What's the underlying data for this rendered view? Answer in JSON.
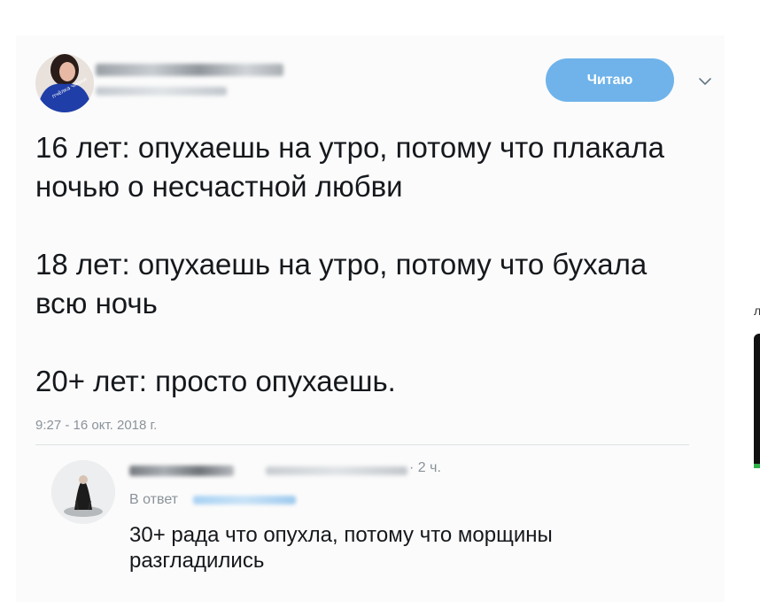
{
  "tweet": {
    "follow_label": "Читаю",
    "paragraphs": [
      "16 лет: опухаешь на утро, потому что плакала ночью о несчастной любви",
      "18 лет: опухаешь на утро, потому что бухала всю ночь",
      "20+ лет: просто опухаешь."
    ],
    "timestamp": "9:27 - 16 окт. 2018 г.",
    "avatar_text": "пчёлка чмоки"
  },
  "reply": {
    "time": "· 2 ч.",
    "in_reply_to_label": "В ответ",
    "text": "30+ рада что опухла, потому что морщины разгладились"
  },
  "edge": {
    "char": "л"
  },
  "colors": {
    "follow_button": "#6fb3ea",
    "text": "#15181c",
    "muted": "#8a9299"
  }
}
